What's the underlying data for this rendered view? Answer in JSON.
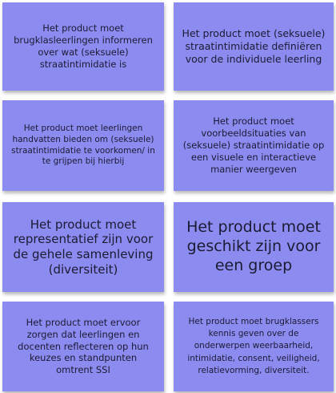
{
  "notes": [
    {
      "text": "Het product moet brugklasleerlingen informeren over wat (seksuele) straatintimidatie is"
    },
    {
      "text": "Het product moet (seksuele) straatintimidatie definiëren voor de individuele leerling"
    },
    {
      "text": "Het product moet leerlingen handvatten bieden om (seksuele) straatintimidatie te voorkomen/ in te grijpen bij hierbij"
    },
    {
      "text": "Het product moet voorbeeldsituaties van (seksuele) straatintimidatie op een visuele en interactieve manier weergeven"
    },
    {
      "text": "Het product moet representatief zijn voor de gehele samenleving (diversiteit)"
    },
    {
      "text": "Het product moet geschikt zijn voor een groep"
    },
    {
      "text": "Het product moet ervoor zorgen dat leerlingen en docenten reflecteren op hun keuzes en standpunten omtrent SSI"
    },
    {
      "text": "Het product moet brugklassers kennis geven over de onderwerpen weerbaarheid, intimidatie, consent, veiligheid, relatievorming, diversiteit."
    }
  ],
  "colors": {
    "note": "#8c8bf0",
    "text": "#1b1b33",
    "background": "#ffffff"
  }
}
